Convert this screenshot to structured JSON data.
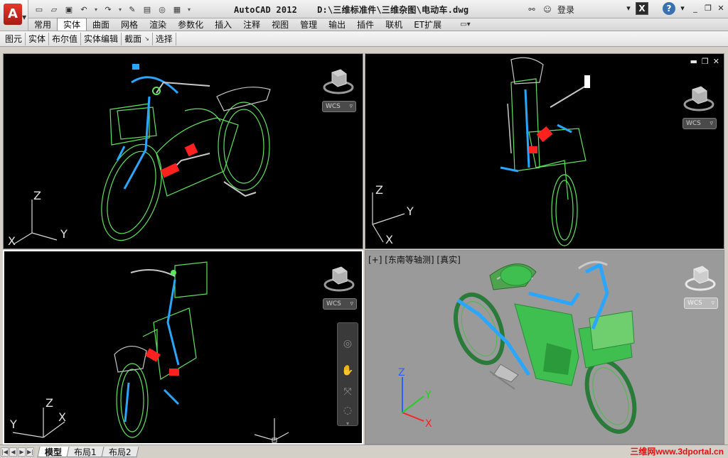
{
  "window": {
    "app_title": "AutoCAD 2012",
    "file_path": "D:\\三维标准件\\三维杂图\\电动车.dwg",
    "login_label": "登录"
  },
  "quick_access": [
    "new-icon",
    "open-icon",
    "save-icon",
    "undo-icon",
    "redo-icon",
    "plot-icon",
    "saveas-icon",
    "print-preview-icon",
    "publish-icon",
    "customize-icon"
  ],
  "ribbon": {
    "tabs": [
      "常用",
      "实体",
      "曲面",
      "网格",
      "渲染",
      "参数化",
      "插入",
      "注释",
      "视图",
      "管理",
      "输出",
      "插件",
      "联机",
      "ET扩展"
    ],
    "active_tab": "实体"
  },
  "panels": [
    {
      "label": "图元"
    },
    {
      "label": "实体"
    },
    {
      "label": "布尔值"
    },
    {
      "label": "实体编辑"
    },
    {
      "label": "截面",
      "launcher": "↘"
    },
    {
      "label": "选择"
    }
  ],
  "viewports": {
    "top_left": {
      "ucs": {
        "z": "Z",
        "x": "X",
        "y": "Y"
      },
      "wcs": "WCS"
    },
    "top_right": {
      "ucs": {
        "z": "Z",
        "x": "X",
        "y": "Y"
      },
      "wcs": "WCS"
    },
    "bottom_left": {
      "ucs": {
        "z": "Z",
        "x": "X",
        "y": "Y"
      },
      "wcs": "WCS"
    },
    "bottom_right": {
      "label": "[+] [东南等轴测] [真实]",
      "ucs": {
        "z": "Z",
        "x": "X",
        "y": "Y"
      },
      "wcs": "WCS"
    }
  },
  "layout_tabs": [
    "模型",
    "布局1",
    "布局2"
  ],
  "active_layout": "模型",
  "watermark": "三维网www.3dportal.cn",
  "colors": {
    "wire_green": "#5ee35e",
    "wire_blue": "#2aa6ff",
    "wire_red": "#ff2020",
    "wire_white": "#d8d8d8",
    "shaded_bg": "#9a9a9a",
    "title_red": "#d42a1a"
  }
}
